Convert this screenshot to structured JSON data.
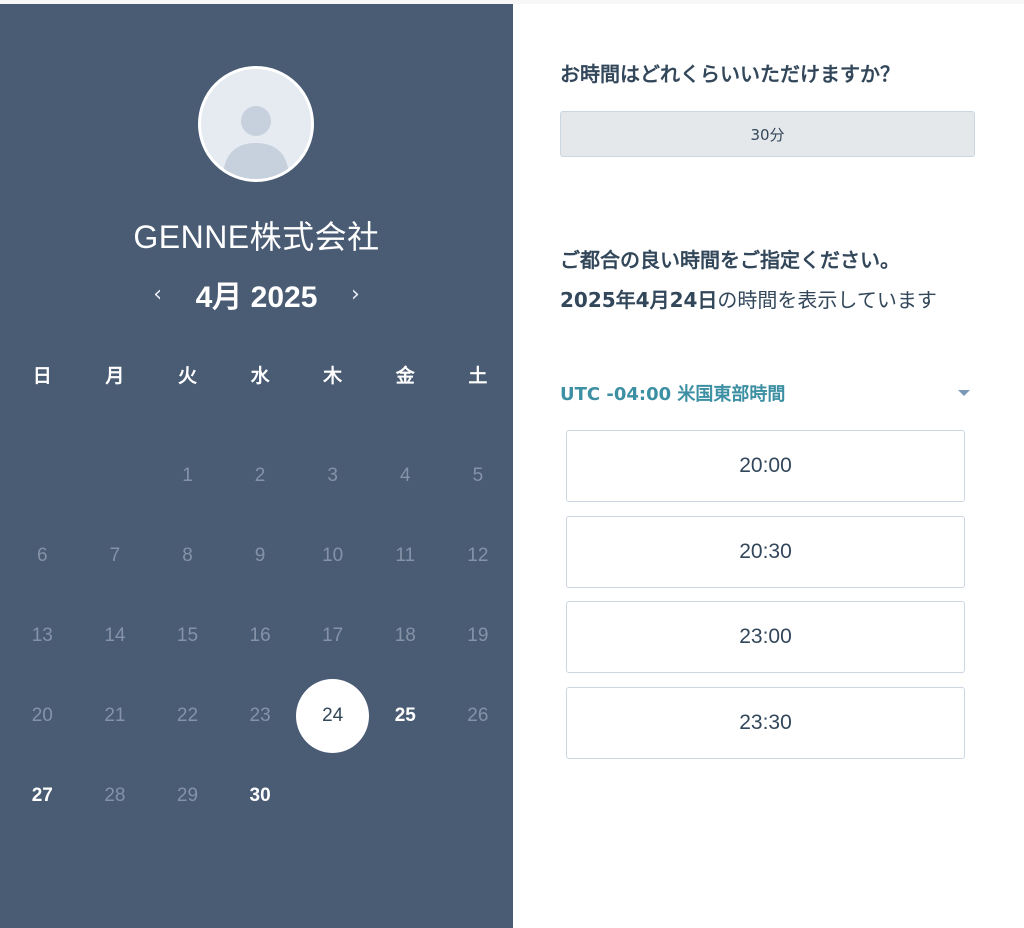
{
  "company_name": "GENNE株式会社",
  "calendar": {
    "prev_icon": "‹",
    "next_icon": "›",
    "month_label": "4月",
    "year_label": "2025",
    "weekdays": [
      "日",
      "月",
      "火",
      "水",
      "木",
      "金",
      "土"
    ],
    "days": {
      "d1": "1",
      "d2": "2",
      "d3": "3",
      "d4": "4",
      "d5": "5",
      "d6": "6",
      "d7": "7",
      "d8": "8",
      "d9": "9",
      "d10": "10",
      "d11": "11",
      "d12": "12",
      "d13": "13",
      "d14": "14",
      "d15": "15",
      "d16": "16",
      "d17": "17",
      "d18": "18",
      "d19": "19",
      "d20": "20",
      "d21": "21",
      "d22": "22",
      "d23": "23",
      "d24": "24",
      "d25": "25",
      "d26": "26",
      "d27": "27",
      "d28": "28",
      "d29": "29",
      "d30": "30"
    },
    "selected_day": "24",
    "available_days": [
      "24",
      "25",
      "27",
      "30"
    ]
  },
  "duration": {
    "question": "お時間はどれくらいいただけますか？",
    "selected": "30分"
  },
  "time_selection": {
    "question": "ご都合の良い時間をご指定ください。",
    "date_bold": "2025年4月24日",
    "date_suffix": "の時間を表示しています",
    "timezone": "UTC -04:00 米国東部時間",
    "slots": [
      "20:00",
      "20:30",
      "23:00",
      "23:30"
    ]
  },
  "colors": {
    "sidebar": "#4a5b74",
    "accent": "#3d8fa3",
    "text": "#33475b"
  }
}
